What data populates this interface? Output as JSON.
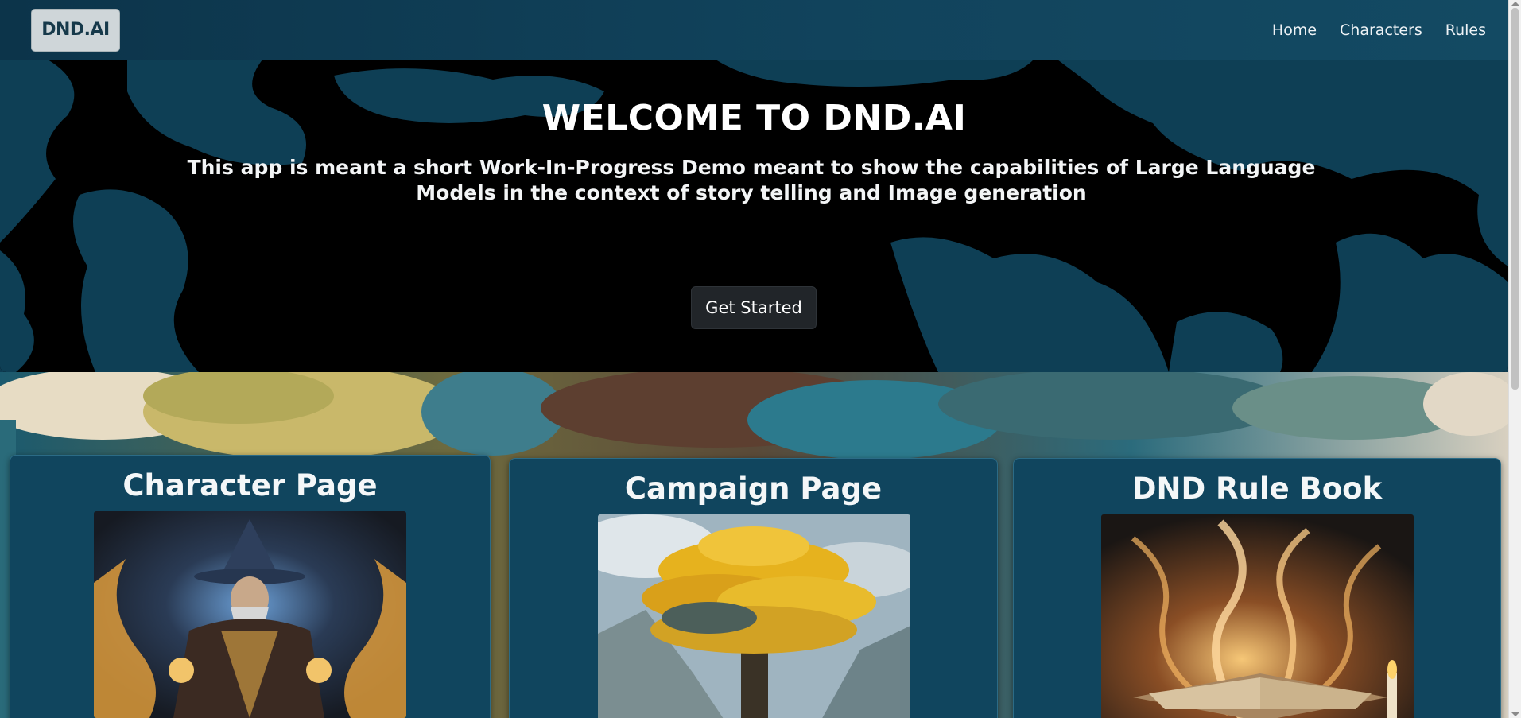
{
  "nav": {
    "logo_text": "DND.AI",
    "links": [
      {
        "label": "Home"
      },
      {
        "label": "Characters"
      },
      {
        "label": "Rules"
      }
    ]
  },
  "hero": {
    "title": "WELCOME TO DND.AI",
    "subtitle": "This app is meant a short Work-In-Progress Demo meant to show the capabilities of Large Language Models in the context of story telling and Image generation",
    "cta_label": "Get Started"
  },
  "cards": [
    {
      "title": "Character Page",
      "image": "wizard-illustration"
    },
    {
      "title": "Campaign Page",
      "image": "golden-tree-illustration"
    },
    {
      "title": "DND Rule Book",
      "image": "flaming-book-illustration"
    }
  ],
  "colors": {
    "navbar": "#0c344a",
    "hero_bg": "#000000",
    "hero_pattern": "#0e3f55",
    "card_bg": "#10455e",
    "button_bg": "#212529"
  }
}
